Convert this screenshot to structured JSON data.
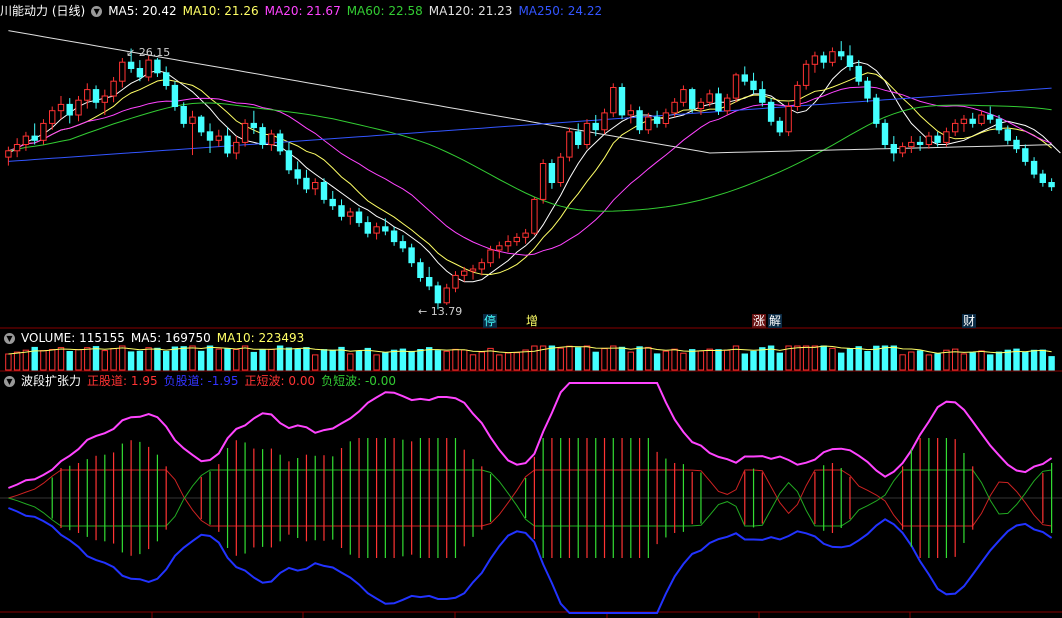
{
  "stock": {
    "title": "川能动力 (日线)"
  },
  "main_panel": {
    "indicators": [
      {
        "key": "MA5",
        "label": "MA5: 20.42",
        "color": "#ffffff"
      },
      {
        "key": "MA10",
        "label": "MA10: 21.26",
        "color": "#ffff66"
      },
      {
        "key": "MA20",
        "label": "MA20: 21.67",
        "color": "#ff44ff"
      },
      {
        "key": "MA60",
        "label": "MA60: 22.58",
        "color": "#33cc33"
      },
      {
        "key": "MA120",
        "label": "MA120: 21.23",
        "color": "#e0e0e0"
      },
      {
        "key": "MA250",
        "label": "MA250: 24.22",
        "color": "#3355ff"
      }
    ],
    "high_label": "26.15",
    "low_label": "13.79",
    "events": [
      "停",
      "增",
      "涨",
      "解",
      "财"
    ]
  },
  "volume_panel": {
    "indicators": [
      {
        "label": "VOLUME: 115155",
        "color": "#ffffff"
      },
      {
        "label": "MA5: 169750",
        "color": "#ffffff"
      },
      {
        "label": "MA10: 223493",
        "color": "#ffff66"
      }
    ]
  },
  "osc_panel": {
    "title": "波段扩张力",
    "indicators": [
      {
        "label": "正股道: 1.95",
        "color": "#ff3333"
      },
      {
        "label": "负股道: -1.95",
        "color": "#3333ff"
      },
      {
        "label": "正短波: 0.00",
        "color": "#ff3333"
      },
      {
        "label": "负短波: -0.00",
        "color": "#33cc33"
      }
    ]
  },
  "colors": {
    "up": "#ff3333",
    "down": "#44ffff",
    "bg": "#000000",
    "grid": "#880000"
  },
  "chart_data": [
    {
      "type": "candlestick",
      "ylim": [
        13,
        27.5
      ],
      "candles": [
        [
          21.0,
          21.5,
          20.6,
          21.3
        ],
        [
          21.3,
          21.9,
          21.0,
          21.6
        ],
        [
          21.6,
          22.2,
          21.3,
          22.0
        ],
        [
          22.0,
          22.6,
          21.6,
          21.8
        ],
        [
          21.8,
          22.8,
          21.6,
          22.6
        ],
        [
          22.6,
          23.4,
          22.3,
          23.2
        ],
        [
          23.2,
          23.9,
          22.8,
          23.5
        ],
        [
          23.5,
          23.8,
          22.6,
          23.0
        ],
        [
          23.0,
          23.9,
          22.7,
          23.7
        ],
        [
          23.7,
          24.5,
          23.3,
          24.2
        ],
        [
          24.2,
          24.4,
          23.3,
          23.6
        ],
        [
          23.6,
          24.2,
          23.0,
          23.9
        ],
        [
          23.9,
          24.8,
          23.6,
          24.6
        ],
        [
          24.6,
          25.7,
          24.3,
          25.5
        ],
        [
          25.5,
          26.15,
          25.0,
          25.2
        ],
        [
          25.2,
          25.6,
          24.6,
          24.8
        ],
        [
          24.8,
          25.8,
          24.6,
          25.6
        ],
        [
          25.6,
          25.7,
          24.8,
          25.0
        ],
        [
          25.0,
          25.3,
          24.2,
          24.4
        ],
        [
          24.4,
          24.6,
          23.2,
          23.4
        ],
        [
          23.4,
          23.6,
          22.4,
          22.6
        ],
        [
          22.6,
          23.2,
          21.1,
          22.9
        ],
        [
          22.9,
          23.0,
          22.0,
          22.2
        ],
        [
          22.2,
          22.6,
          21.2,
          21.8
        ],
        [
          21.8,
          22.3,
          21.5,
          22.0
        ],
        [
          22.0,
          22.4,
          21.0,
          21.2
        ],
        [
          21.2,
          22.0,
          20.9,
          21.7
        ],
        [
          21.7,
          22.8,
          21.5,
          22.6
        ],
        [
          22.6,
          23.2,
          22.1,
          22.4
        ],
        [
          22.4,
          22.6,
          21.4,
          21.6
        ],
        [
          21.6,
          22.3,
          21.3,
          22.1
        ],
        [
          22.1,
          22.3,
          21.1,
          21.3
        ],
        [
          21.3,
          21.7,
          20.2,
          20.4
        ],
        [
          20.4,
          20.8,
          19.7,
          20.0
        ],
        [
          20.0,
          20.4,
          19.3,
          19.5
        ],
        [
          19.5,
          20.0,
          19.2,
          19.8
        ],
        [
          19.8,
          20.0,
          18.8,
          19.0
        ],
        [
          19.0,
          19.4,
          18.5,
          18.7
        ],
        [
          18.7,
          19.0,
          18.0,
          18.2
        ],
        [
          18.2,
          18.6,
          17.8,
          18.4
        ],
        [
          18.4,
          18.6,
          17.7,
          17.9
        ],
        [
          17.9,
          18.2,
          17.2,
          17.4
        ],
        [
          17.4,
          17.9,
          17.1,
          17.7
        ],
        [
          17.7,
          18.1,
          17.3,
          17.5
        ],
        [
          17.5,
          17.7,
          16.8,
          17.0
        ],
        [
          17.0,
          17.3,
          16.5,
          16.7
        ],
        [
          16.7,
          16.9,
          15.8,
          16.0
        ],
        [
          16.0,
          16.2,
          15.1,
          15.3
        ],
        [
          15.3,
          15.8,
          14.7,
          14.9
        ],
        [
          14.9,
          15.1,
          13.79,
          14.1
        ],
        [
          14.1,
          15.0,
          14.0,
          14.8
        ],
        [
          14.8,
          15.6,
          14.6,
          15.4
        ],
        [
          15.4,
          15.8,
          15.1,
          15.6
        ],
        [
          15.6,
          15.9,
          15.2,
          15.7
        ],
        [
          15.7,
          16.2,
          15.4,
          16.0
        ],
        [
          16.0,
          16.8,
          15.8,
          16.6
        ],
        [
          16.6,
          17.0,
          16.2,
          16.8
        ],
        [
          16.8,
          17.3,
          16.5,
          17.0
        ],
        [
          17.0,
          17.4,
          16.8,
          17.2
        ],
        [
          17.2,
          17.6,
          16.9,
          17.4
        ],
        [
          17.4,
          19.1,
          17.3,
          19.0
        ],
        [
          19.0,
          20.9,
          18.8,
          20.7
        ],
        [
          20.7,
          20.9,
          19.5,
          19.8
        ],
        [
          19.8,
          21.2,
          19.6,
          21.0
        ],
        [
          21.0,
          22.4,
          20.8,
          22.2
        ],
        [
          22.2,
          22.6,
          21.4,
          21.6
        ],
        [
          21.6,
          22.8,
          21.4,
          22.6
        ],
        [
          22.6,
          23.0,
          22.0,
          22.3
        ],
        [
          22.3,
          23.3,
          22.1,
          23.1
        ],
        [
          23.1,
          24.5,
          22.9,
          24.3
        ],
        [
          24.3,
          24.5,
          22.8,
          23.0
        ],
        [
          23.0,
          23.5,
          22.6,
          23.2
        ],
        [
          23.2,
          23.4,
          22.1,
          22.3
        ],
        [
          22.3,
          23.1,
          22.1,
          22.9
        ],
        [
          22.9,
          23.2,
          22.4,
          22.6
        ],
        [
          22.6,
          23.3,
          22.4,
          23.1
        ],
        [
          23.1,
          23.8,
          22.9,
          23.6
        ],
        [
          23.6,
          24.4,
          23.4,
          24.2
        ],
        [
          24.2,
          24.3,
          23.1,
          23.3
        ],
        [
          23.3,
          23.8,
          23.0,
          23.6
        ],
        [
          23.6,
          24.2,
          23.4,
          24.0
        ],
        [
          24.0,
          24.3,
          23.0,
          23.2
        ],
        [
          23.2,
          24.0,
          23.0,
          23.8
        ],
        [
          23.8,
          25.0,
          23.6,
          24.9
        ],
        [
          24.9,
          25.3,
          24.4,
          24.6
        ],
        [
          24.6,
          25.0,
          24.0,
          24.2
        ],
        [
          24.2,
          24.6,
          23.4,
          23.6
        ],
        [
          23.6,
          23.8,
          22.5,
          22.7
        ],
        [
          22.7,
          22.9,
          22.0,
          22.2
        ],
        [
          22.2,
          23.6,
          22.0,
          23.4
        ],
        [
          23.4,
          24.6,
          23.2,
          24.4
        ],
        [
          24.4,
          25.6,
          24.2,
          25.4
        ],
        [
          25.4,
          26.0,
          25.0,
          25.8
        ],
        [
          25.8,
          26.0,
          25.2,
          25.5
        ],
        [
          25.5,
          26.2,
          25.3,
          26.0
        ],
        [
          26.0,
          26.5,
          25.6,
          25.8
        ],
        [
          25.8,
          26.3,
          25.1,
          25.3
        ],
        [
          25.3,
          25.6,
          24.4,
          24.6
        ],
        [
          24.6,
          24.8,
          23.6,
          23.8
        ],
        [
          23.8,
          24.0,
          22.4,
          22.6
        ],
        [
          22.6,
          22.8,
          21.4,
          21.6
        ],
        [
          21.6,
          22.0,
          20.8,
          21.2
        ],
        [
          21.2,
          21.7,
          21.0,
          21.5
        ],
        [
          21.5,
          22.0,
          21.2,
          21.7
        ],
        [
          21.7,
          22.0,
          21.3,
          21.6
        ],
        [
          21.6,
          22.2,
          21.4,
          22.0
        ],
        [
          22.0,
          22.2,
          21.5,
          21.7
        ],
        [
          21.7,
          22.4,
          21.5,
          22.2
        ],
        [
          22.2,
          22.8,
          22.0,
          22.6
        ],
        [
          22.6,
          23.0,
          22.2,
          22.8
        ],
        [
          22.8,
          23.1,
          22.4,
          22.6
        ],
        [
          22.6,
          23.2,
          22.5,
          23.0
        ],
        [
          23.0,
          23.4,
          22.6,
          22.8
        ],
        [
          22.8,
          23.0,
          22.1,
          22.3
        ],
        [
          22.3,
          22.5,
          21.6,
          21.8
        ],
        [
          21.8,
          22.0,
          21.2,
          21.4
        ],
        [
          21.4,
          21.6,
          20.6,
          20.8
        ],
        [
          20.8,
          21.0,
          20.0,
          20.2
        ],
        [
          20.2,
          20.4,
          19.6,
          19.8
        ],
        [
          19.8,
          20.0,
          19.4,
          19.6
        ]
      ],
      "ma": {
        "MA5": [
          21.2,
          21.4,
          21.7,
          21.9,
          22.1,
          22.4,
          22.8,
          23.1,
          23.4,
          23.6,
          23.7,
          23.8,
          23.9,
          24.2,
          24.5,
          24.7,
          25.0,
          25.1,
          25.0,
          24.7,
          24.4,
          24.1,
          23.7,
          23.3,
          22.8,
          22.4,
          22.0,
          21.8,
          21.7,
          21.6,
          21.6,
          21.5,
          21.2,
          20.9,
          20.5,
          20.2,
          19.9,
          19.6,
          19.3,
          19.0,
          18.7,
          18.5,
          18.2,
          18.0,
          17.7,
          17.5,
          17.2,
          16.9,
          16.5,
          16.0,
          15.6,
          15.3,
          15.1,
          15.1,
          15.2,
          15.5,
          15.8,
          16.1,
          16.5,
          16.8,
          17.2,
          17.8,
          18.5,
          19.2,
          20.0,
          20.7,
          21.3,
          21.7,
          22.1,
          22.4,
          22.7,
          22.9,
          23.0,
          23.0,
          22.9,
          22.8,
          22.9,
          23.0,
          23.2,
          23.4,
          23.5,
          23.6,
          23.6,
          23.7,
          23.8,
          24.0,
          24.0,
          23.9,
          23.6,
          23.3,
          23.1,
          23.2,
          23.6,
          24.1,
          24.7,
          25.1,
          25.4,
          25.5,
          25.4,
          25.1,
          24.6,
          23.9,
          23.2,
          22.6,
          22.2,
          21.8,
          21.6,
          21.6,
          21.7,
          21.8,
          22.0,
          22.2,
          22.4,
          22.6,
          22.7,
          22.6,
          22.5,
          22.3,
          22.0,
          21.6,
          21.2
        ]
      }
    }
  ]
}
